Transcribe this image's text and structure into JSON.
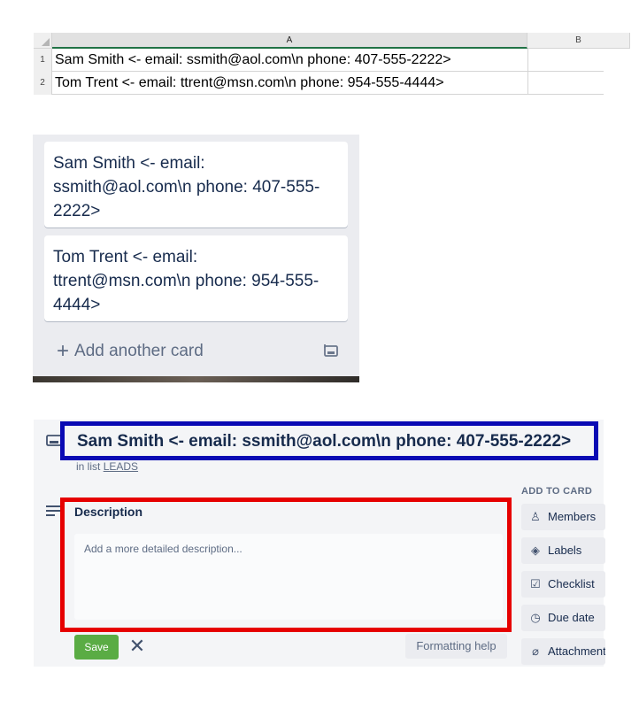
{
  "spreadsheet": {
    "columns": [
      "A",
      "B"
    ],
    "rows": [
      {
        "num": "1",
        "a": "Sam Smith <- email: ssmith@aol.com\\n phone: 407-555-2222>"
      },
      {
        "num": "2",
        "a": "Tom Trent <- email: ttrent@msn.com\\n phone: 954-555-4444>"
      }
    ]
  },
  "trello_list": {
    "cards": [
      {
        "text": "Sam Smith <- email: ssmith@aol.com\\n phone: 407-555-2222>"
      },
      {
        "text": "Tom Trent <- email: ttrent@msn.com\\n phone: 954-555-4444>"
      }
    ],
    "add_card_label": "Add another card",
    "add_card_icon": "plus-icon",
    "template_icon": "card-template-icon"
  },
  "card_detail": {
    "title": "Sam Smith <- email: ssmith@aol.com\\n phone: 407-555-2222>",
    "in_list_prefix": "in list ",
    "list_name": "LEADS",
    "description_label": "Description",
    "description_placeholder": "Add a more detailed description...",
    "save_label": "Save",
    "formatting_help_label": "Formatting help",
    "add_to_card_heading": "ADD TO CARD",
    "sidebar_buttons": [
      {
        "label": "Members",
        "icon": "person-icon"
      },
      {
        "label": "Labels",
        "icon": "tag-icon"
      },
      {
        "label": "Checklist",
        "icon": "checklist-icon"
      },
      {
        "label": "Due date",
        "icon": "clock-icon"
      },
      {
        "label": "Attachment",
        "icon": "paperclip-icon"
      }
    ],
    "highlight_colors": {
      "title_box": "#0a0ab4",
      "description_box": "#e60000"
    }
  }
}
